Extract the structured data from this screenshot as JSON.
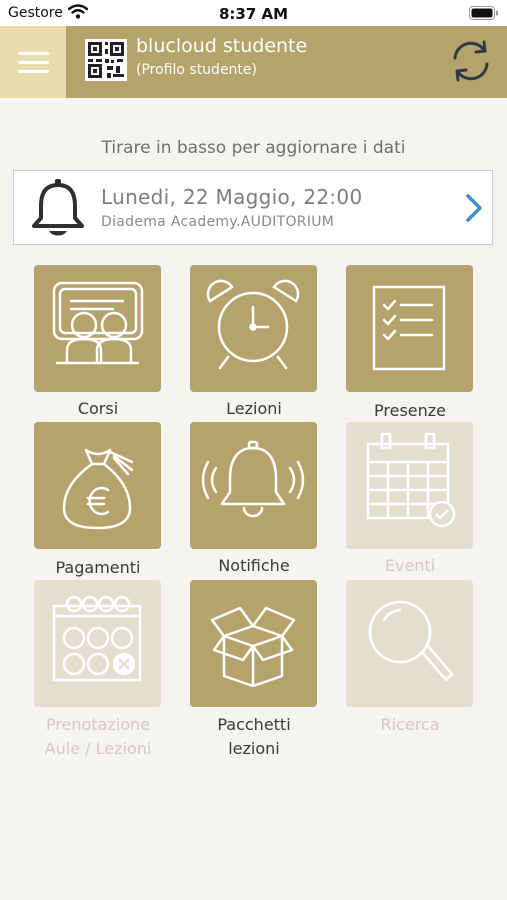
{
  "status_bar": {
    "carrier": "Gestore",
    "time": "8:37 AM"
  },
  "header": {
    "title": "blucloud studente",
    "subtitle": "(Profilo studente)"
  },
  "pull_hint": "Tirare in basso per aggiornare i dati",
  "next_event": {
    "date": "Lunedi, 22 Maggio, 22:00",
    "place": "Diadema Academy.AUDITORIUM"
  },
  "tiles": [
    {
      "label": "Corsi",
      "enabled": true,
      "icon": "students-board-icon"
    },
    {
      "label": "Lezioni",
      "enabled": true,
      "icon": "alarm-clock-icon"
    },
    {
      "label": "Presenze",
      "enabled": true,
      "icon": "checklist-icon"
    },
    {
      "label": "Pagamenti",
      "enabled": true,
      "icon": "money-bag-icon"
    },
    {
      "label": "Notifiche",
      "enabled": true,
      "icon": "ringing-bell-icon"
    },
    {
      "label": "Eventi",
      "enabled": false,
      "icon": "calendar-icon"
    },
    {
      "label_line1": "Prenotazione",
      "label_line2": "Aule / Lezioni",
      "enabled": false,
      "icon": "booking-calendar-icon"
    },
    {
      "label_line1": "Pacchetti",
      "label_line2": "lezioni",
      "enabled": true,
      "icon": "open-box-icon"
    },
    {
      "label": "Ricerca",
      "enabled": false,
      "icon": "magnifier-icon"
    }
  ],
  "colors": {
    "tile_active": "#b6a36b",
    "tile_disabled": "#e3ded0",
    "header": "#b6a36b",
    "menu": "#e8dcaf",
    "chevron": "#3b8fd1"
  }
}
